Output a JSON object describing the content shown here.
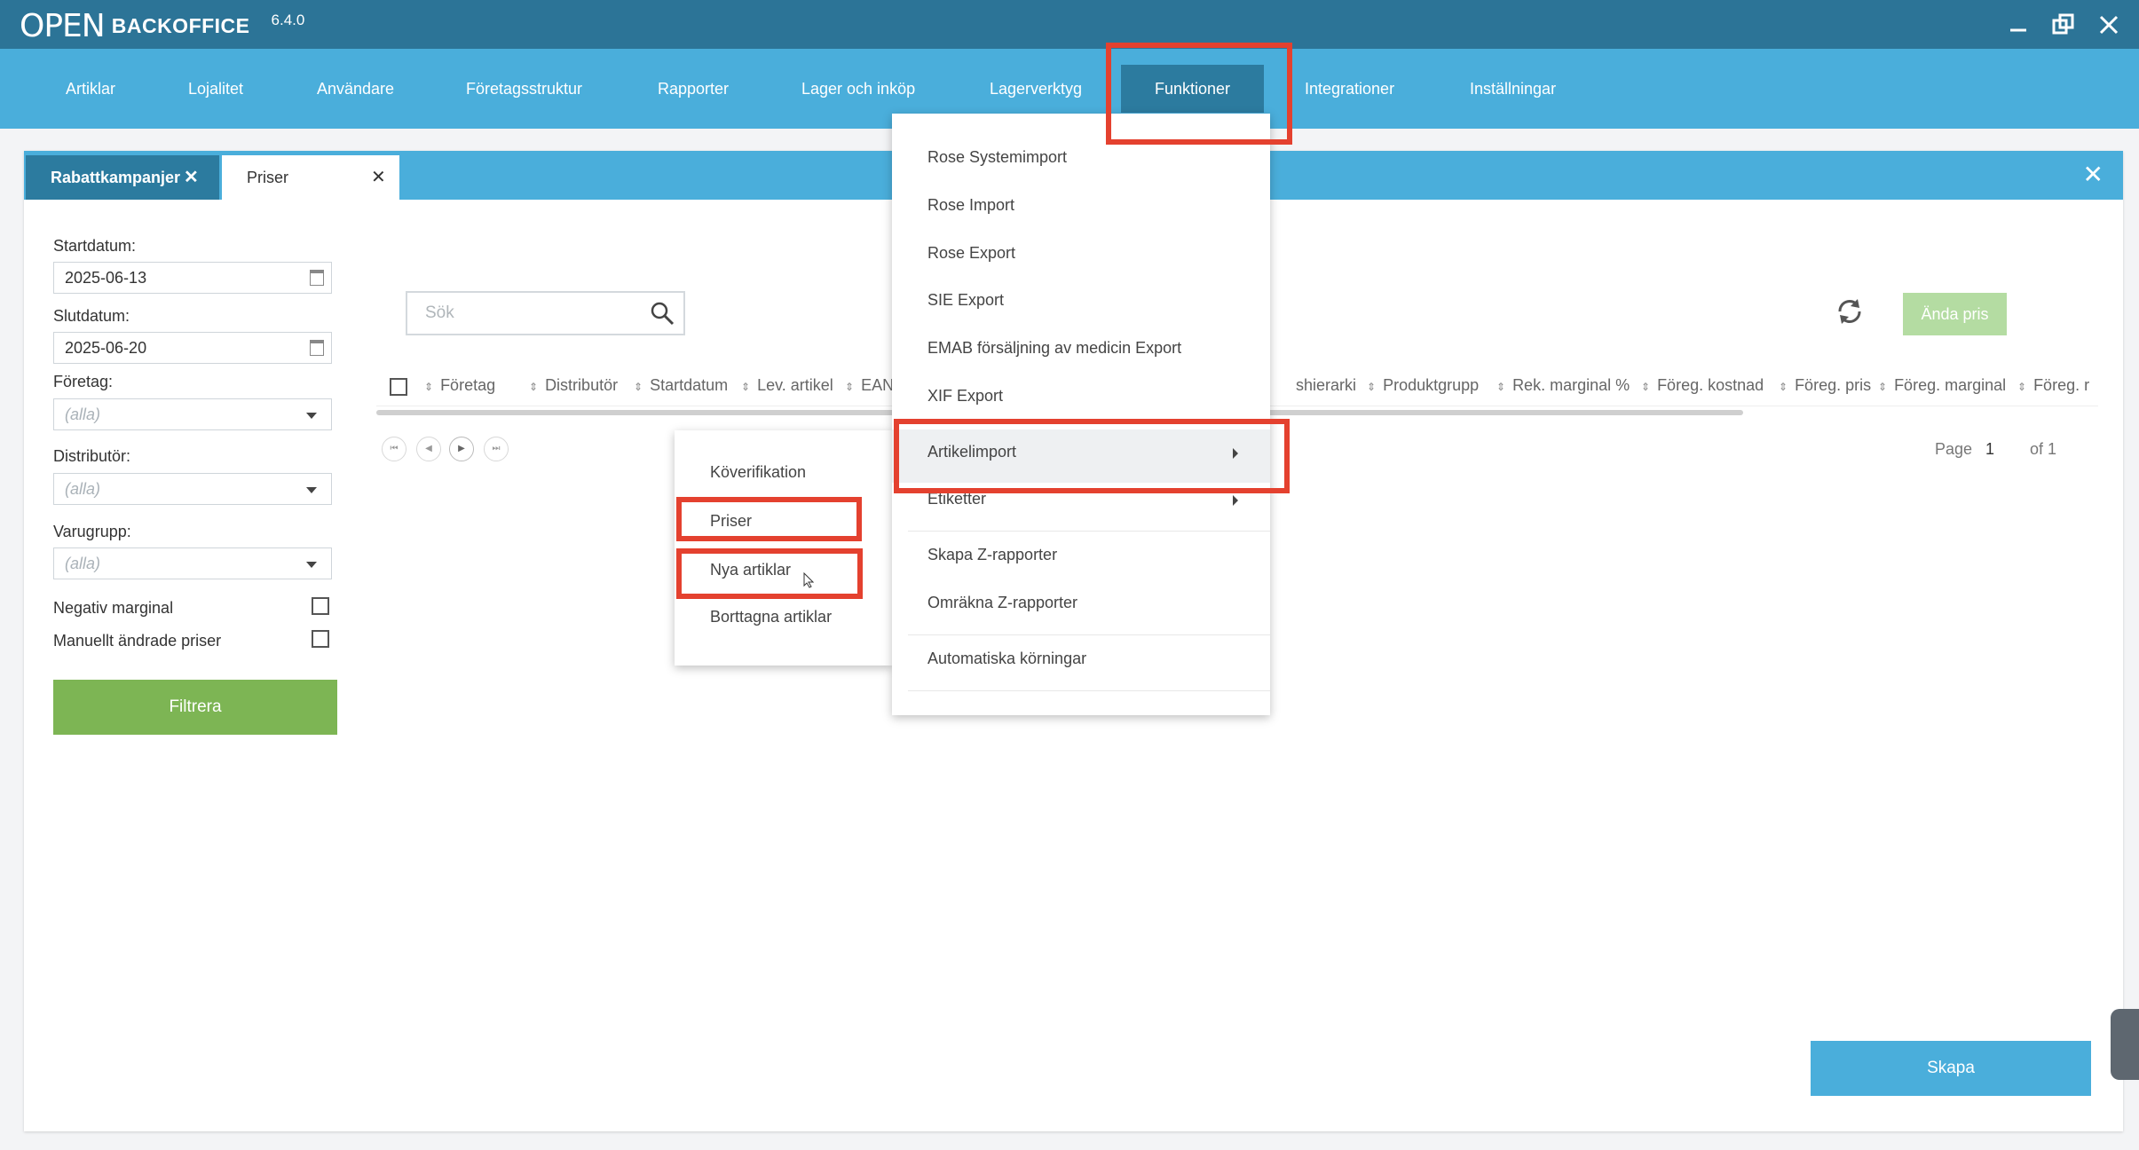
{
  "app": {
    "logo_mark": "OPEN",
    "logo_text": "BACKOFFICE",
    "version": "6.4.0"
  },
  "menu": {
    "items": [
      "Artiklar",
      "Lojalitet",
      "Användare",
      "Företagsstruktur",
      "Rapporter",
      "Lager och inköp",
      "Lagerverktyg",
      "Funktioner",
      "Integrationer",
      "Inställningar"
    ],
    "active": "Funktioner"
  },
  "tabs": [
    {
      "label": "Rabattkampanjer"
    },
    {
      "label": "Priser"
    }
  ],
  "filters": {
    "start_label": "Startdatum:",
    "start_value": "2025-06-13",
    "end_label": "Slutdatum:",
    "end_value": "2025-06-20",
    "company_label": "Företag:",
    "company_value": "(alla)",
    "distributor_label": "Distributör:",
    "distributor_value": "(alla)",
    "group_label": "Varugrupp:",
    "group_value": "(alla)",
    "neg_margin_label": "Negativ marginal",
    "manual_label": "Manuellt ändrade priser",
    "filter_button": "Filtrera"
  },
  "grid": {
    "search_placeholder": "Sök",
    "change_price_button": "Ända pris",
    "columns_left": [
      "Företag",
      "Distributör",
      "Startdatum",
      "Lev. artikel",
      "EAN"
    ],
    "columns_right": [
      "shierarki",
      "Produktgrupp",
      "Rek. marginal %",
      "Föreg. kostnad",
      "Föreg. pris",
      "Föreg. marginal",
      "Föreg. r"
    ],
    "page_label": "Page",
    "page_current": "1",
    "page_of": "of 1"
  },
  "dropdown": {
    "items": [
      "Rose Systemimport",
      "Rose Import",
      "Rose Export",
      "SIE Export",
      "EMAB försäljning av medicin Export",
      "XIF Export",
      "Artikelimport",
      "Etiketter",
      "Skapa Z-rapporter",
      "Omräkna Z-rapporter",
      "Automatiska körningar"
    ]
  },
  "submenu": {
    "items": [
      "Köverifikation",
      "Priser",
      "Nya artiklar",
      "Borttagna artiklar"
    ]
  },
  "actions": {
    "create_button": "Skapa"
  },
  "colors": {
    "titlebar": "#2c7497",
    "menubar": "#4aaedb",
    "active_menu": "#2c7b9f",
    "filter_button": "#7db554",
    "annotation": "#e4412f"
  }
}
